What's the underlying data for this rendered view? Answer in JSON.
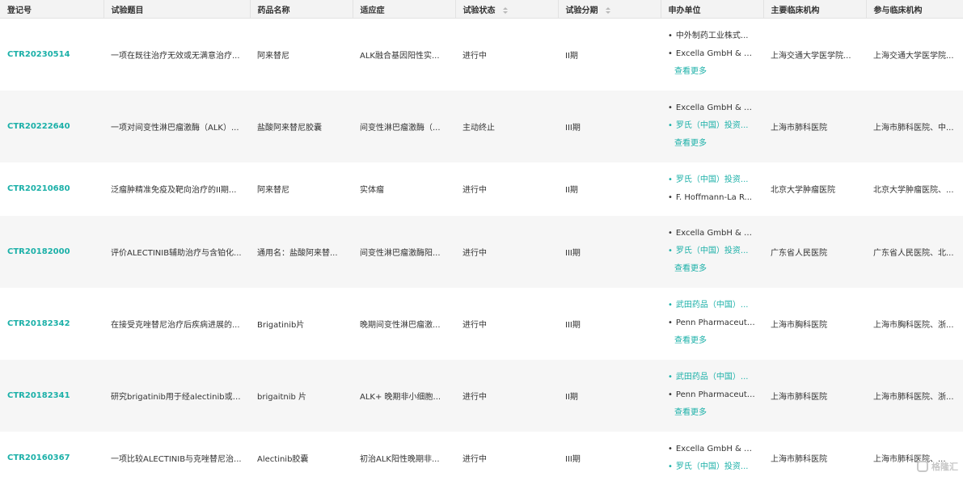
{
  "table": {
    "headers": [
      "登记号",
      "试验题目",
      "药品名称",
      "适应症",
      "试验状态",
      "试验分期",
      "申办单位",
      "主要临床机构",
      "参与临床机构"
    ],
    "more_label": "查看更多",
    "rows": [
      {
        "id": "CTR20230514",
        "title": "一项在既往治疗无效或无满意治疗...",
        "drug": "阿来替尼",
        "indication": "ALK融合基因阳性实...",
        "status": "进行中",
        "phase": "II期",
        "sponsors": [
          "中外制药工业株式...",
          "Excella GmbH & C..."
        ],
        "more": true,
        "main_site": "上海交通大学医学院...",
        "sites": "上海交通大学医学院..."
      },
      {
        "id": "CTR20222640",
        "title": "一项对间变性淋巴瘤激酶（ALK）...",
        "drug": "盐酸阿来替尼胶囊",
        "indication": "间变性淋巴瘤激酶（...",
        "status": "主动终止",
        "phase": "III期",
        "sponsors": [
          "Excella GmbH & C...",
          "罗氏（中国）投资..."
        ],
        "more": true,
        "main_site": "上海市肺科医院",
        "sites": "上海市肺科医院、中..."
      },
      {
        "id": "CTR20210680",
        "title": "泛瘤肿精准免疫及靶向治疗的II期...",
        "drug": "阿来替尼",
        "indication": "实体瘤",
        "status": "进行中",
        "phase": "II期",
        "sponsors": [
          "罗氏（中国）投资...",
          "F. Hoffmann-La R..."
        ],
        "more": false,
        "main_site": "北京大学肿瘤医院",
        "sites": "北京大学肿瘤医院、..."
      },
      {
        "id": "CTR20182000",
        "title": "评价ALECTINIB辅助治疗与含铂化...",
        "drug": "通用名：盐酸阿来替...",
        "indication": "间变性淋巴瘤激酶阳...",
        "status": "进行中",
        "phase": "III期",
        "sponsors": [
          "Excella GmbH & C...",
          "罗氏（中国）投资..."
        ],
        "more": true,
        "main_site": "广东省人民医院",
        "sites": "广东省人民医院、北..."
      },
      {
        "id": "CTR20182342",
        "title": "在接受克唑替尼治疗后疾病进展的...",
        "drug": "Brigatinib片",
        "indication": "晚期间变性淋巴瘤激...",
        "status": "进行中",
        "phase": "III期",
        "sponsors": [
          "武田药品（中国）...",
          "Penn Pharmaceuti..."
        ],
        "more": true,
        "main_site": "上海市胸科医院",
        "sites": "上海市胸科医院、浙..."
      },
      {
        "id": "CTR20182341",
        "title": "研究brigatinib用于经alectinib或c...",
        "drug": "brigaitnib 片",
        "indication": "ALK+ 晚期非小细胞...",
        "status": "进行中",
        "phase": "II期",
        "sponsors": [
          "武田药品（中国）...",
          "Penn Pharmaceuti..."
        ],
        "more": true,
        "main_site": "上海市肺科医院",
        "sites": "上海市肺科医院、浙..."
      },
      {
        "id": "CTR20160367",
        "title": "一项比较ALECTINIB与克唑替尼治...",
        "drug": "Alectinib胶囊",
        "indication": "初治ALK阳性晚期非...",
        "status": "进行中",
        "phase": "III期",
        "sponsors": [
          "Excella GmbH & C...",
          "罗氏（中国）投资..."
        ],
        "more": false,
        "main_site": "上海市肺科医院",
        "sites": "上海市肺科医院、..."
      }
    ]
  },
  "link_color": "#1bb0a8",
  "watermark": "格隆汇"
}
